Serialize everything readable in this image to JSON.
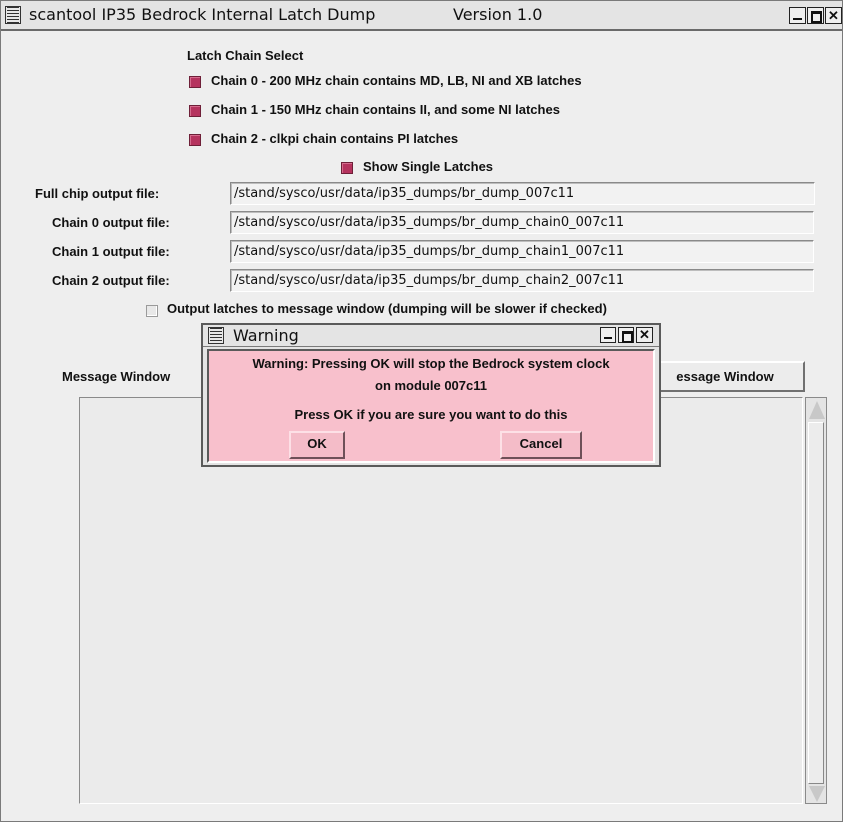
{
  "window": {
    "title": "scantool IP35 Bedrock Internal Latch Dump",
    "version": "Version 1.0"
  },
  "latch_select": {
    "heading": "Latch Chain Select",
    "chains": [
      {
        "label": "Chain 0 - 200 MHz chain contains MD, LB, NI and XB latches",
        "checked": true
      },
      {
        "label": "Chain 1 - 150 MHz chain contains II, and some NI latches",
        "checked": true
      },
      {
        "label": "Chain 2 - clkpi chain contains PI latches",
        "checked": true
      }
    ],
    "show_single": {
      "label": "Show Single Latches",
      "checked": true
    }
  },
  "files": [
    {
      "label": "Full chip output file:",
      "value": "/stand/sysco/usr/data/ip35_dumps/br_dump_007c11"
    },
    {
      "label": "Chain 0 output file:",
      "value": "/stand/sysco/usr/data/ip35_dumps/br_dump_chain0_007c11"
    },
    {
      "label": "Chain 1 output file:",
      "value": "/stand/sysco/usr/data/ip35_dumps/br_dump_chain1_007c11"
    },
    {
      "label": "Chain 2 output file:",
      "value": "/stand/sysco/usr/data/ip35_dumps/br_dump_chain2_007c11"
    }
  ],
  "output_option": {
    "label": "Output latches to message window (dumping will be slower if checked)",
    "checked": false
  },
  "message": {
    "label": "Message Window",
    "clear_button": "essage Window"
  },
  "dialog": {
    "title": "Warning",
    "line1": "Warning: Pressing OK will stop the Bedrock system clock",
    "line2": "on module 007c11",
    "line3": "Press OK if you are sure you want to do this",
    "ok": "OK",
    "cancel": "Cancel"
  },
  "colors": {
    "checkbox_on": "#b5335e",
    "dialog_bg": "#f8c0cc",
    "window_bg": "#eeeeee"
  }
}
